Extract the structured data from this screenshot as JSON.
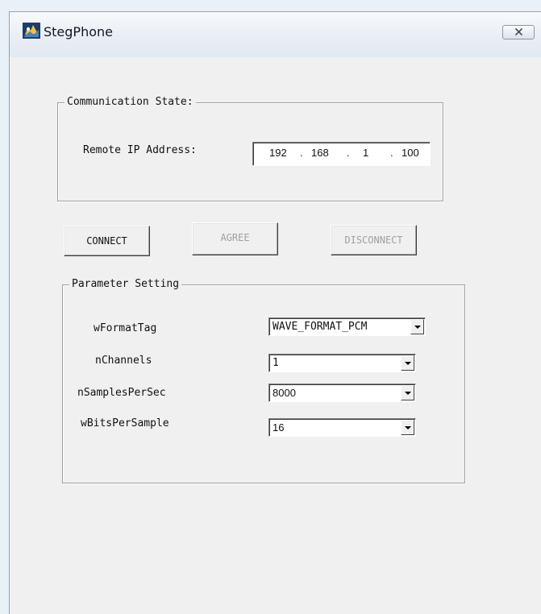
{
  "window": {
    "title": "StegPhone"
  },
  "communication": {
    "legend": "Communication State:",
    "ip_label": "Remote IP Address:",
    "ip": [
      "192",
      "168",
      "1",
      "100"
    ],
    "ip_dot": "."
  },
  "buttons": {
    "connect": "CONNECT",
    "agree": "AGREE",
    "disconnect": "DISCONNECT"
  },
  "params": {
    "legend": "Parameter Setting",
    "rows": [
      {
        "label": "wFormatTag",
        "value": "WAVE_FORMAT_PCM"
      },
      {
        "label": "nChannels",
        "value": "1"
      },
      {
        "label": "nSamplesPerSec",
        "value": "8000"
      },
      {
        "label": "wBitsPerSample",
        "value": "16"
      }
    ]
  }
}
